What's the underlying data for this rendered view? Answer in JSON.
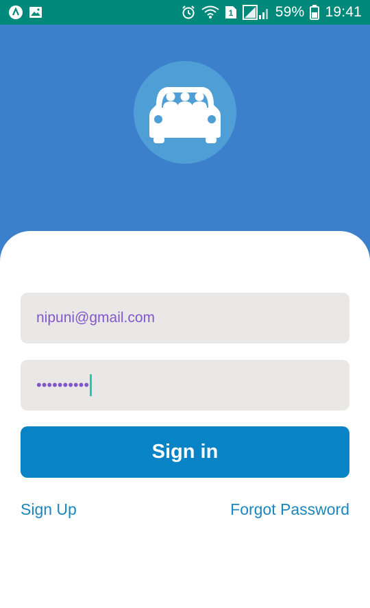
{
  "status_bar": {
    "battery_percent": "59%",
    "time": "19:41",
    "sim_badge": "1",
    "icons": [
      "app-icon",
      "image-icon",
      "alarm-icon",
      "wifi-icon",
      "sim-icon",
      "signal-icon",
      "battery-icon"
    ]
  },
  "header": {
    "logo_icon": "car-passengers-icon",
    "colors": {
      "background": "#3c7fcb",
      "logo_circle": "#4f9fd6"
    }
  },
  "form": {
    "email_value": "nipuni@gmail.com",
    "password_value": "••••••••••",
    "signin_label": "Sign in"
  },
  "links": {
    "signup_label": "Sign Up",
    "forgot_label": "Forgot Password"
  },
  "colors": {
    "status_bar": "#00897b",
    "accent": "#0783c6",
    "link": "#1a86bf",
    "input_text": "#8257c9",
    "input_bg": "#e9e8e6"
  }
}
